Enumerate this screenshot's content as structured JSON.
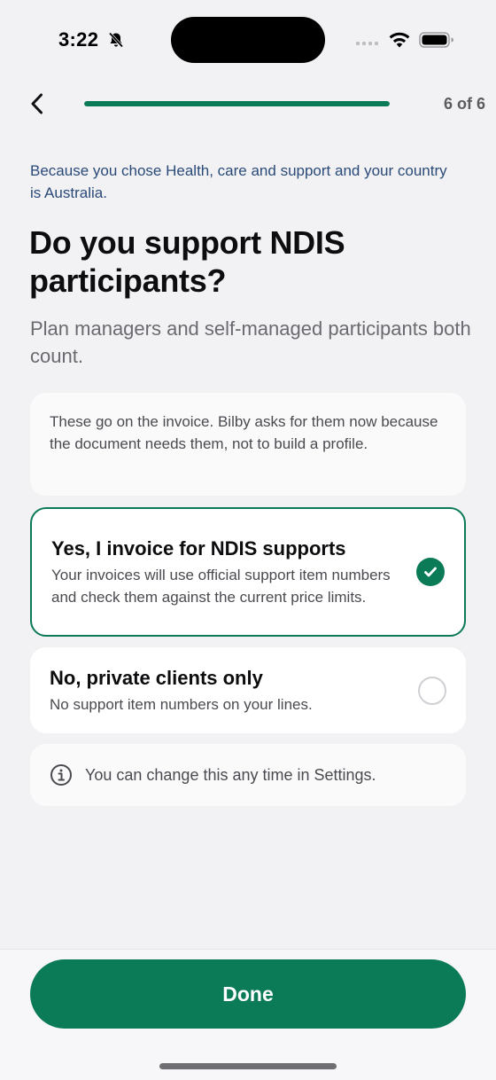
{
  "status_bar": {
    "time": "3:22",
    "icons": [
      "bell-slash-icon",
      "signal-icon",
      "wifi-icon",
      "battery-icon"
    ]
  },
  "nav": {
    "back_icon": "chevron-left-icon",
    "progress": 1.0,
    "step_label": "6 of 6"
  },
  "content": {
    "reason": "Because you chose Health, care and support and your country is Australia.",
    "title": "Do you support NDIS participants?",
    "subtitle": "Plan managers and self-managed participants both count.",
    "info": "These go on the invoice. Bilby asks for them now because the document needs them, not to build a profile.",
    "options": [
      {
        "title": "Yes, I invoice for NDIS supports",
        "description": "Your invoices will use official support item numbers and check them against the current price limits.",
        "selected": true
      },
      {
        "title": "No, private clients only",
        "description": "No support item numbers on your lines.",
        "selected": false
      }
    ],
    "note": "You can change this any time in Settings.",
    "note_icon": "info-circle-icon"
  },
  "footer": {
    "done_label": "Done"
  },
  "colors": {
    "accent": "#0a7a57",
    "background": "#f2f2f4",
    "reason_text": "#2a4a78"
  }
}
